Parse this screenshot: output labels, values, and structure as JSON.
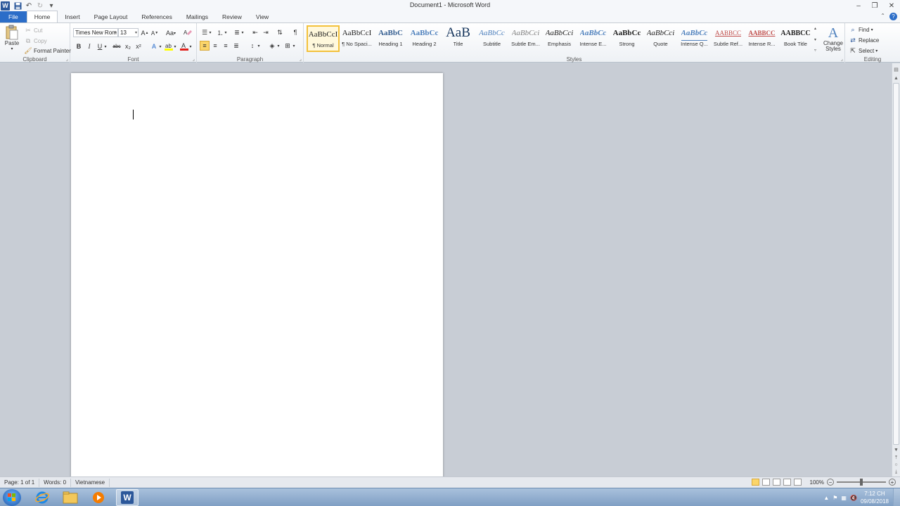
{
  "window": {
    "title": "Document1  -  Microsoft Word",
    "app_icon": "W"
  },
  "tabs": [
    "File",
    "Home",
    "Insert",
    "Page Layout",
    "References",
    "Mailings",
    "Review",
    "View"
  ],
  "active_tab": "Home",
  "clipboard": {
    "paste": "Paste",
    "cut": "Cut",
    "copy": "Copy",
    "format_painter": "Format Painter",
    "label": "Clipboard"
  },
  "font": {
    "family": "Times New Rom",
    "size": "13",
    "label": "Font",
    "bold": "B",
    "italic": "I",
    "underline": "U",
    "strike": "abc",
    "subscript": "x₂",
    "superscript": "x²",
    "change_case": "Aa"
  },
  "paragraph": {
    "label": "Paragraph"
  },
  "styles": {
    "label": "Styles",
    "items": [
      {
        "sample": "AaBbCcI",
        "name": "¶ Normal"
      },
      {
        "sample": "AaBbCcI",
        "name": "¶ No Spaci..."
      },
      {
        "sample": "AaBbC",
        "name": "Heading 1"
      },
      {
        "sample": "AaBbCc",
        "name": "Heading 2"
      },
      {
        "sample": "AaB",
        "name": "Title"
      },
      {
        "sample": "AaBbCc",
        "name": "Subtitle"
      },
      {
        "sample": "AaBbCci",
        "name": "Subtle Em..."
      },
      {
        "sample": "AaBbCci",
        "name": "Emphasis"
      },
      {
        "sample": "AaBbCc",
        "name": "Intense E..."
      },
      {
        "sample": "AaBbCc",
        "name": "Strong"
      },
      {
        "sample": "AaBbCci",
        "name": "Quote"
      },
      {
        "sample": "AaBbCc",
        "name": "Intense Q..."
      },
      {
        "sample": "AABBCC",
        "name": "Subtle Ref..."
      },
      {
        "sample": "AABBCC",
        "name": "Intense R..."
      },
      {
        "sample": "AABBCC",
        "name": "Book Title"
      }
    ],
    "change_styles": "Change Styles"
  },
  "editing": {
    "label": "Editing",
    "find": "Find",
    "replace": "Replace",
    "select": "Select"
  },
  "status": {
    "page": "Page: 1 of 1",
    "words": "Words: 0",
    "language": "Vietnamese",
    "zoom": "100%"
  },
  "taskbar": {
    "time": "7:12 CH",
    "date": "09/08/2018"
  },
  "colors": {
    "file_tab": "#2b6dc8",
    "word_blue": "#2b579a",
    "selected_style": "#f3c13b"
  }
}
